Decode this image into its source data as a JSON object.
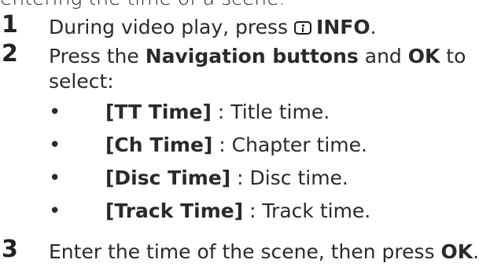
{
  "intro_fragment": "entering the time of a scene.",
  "steps": [
    {
      "number": "1",
      "prefix": "During video play, press ",
      "key_icon": "info-icon",
      "key_label": "INFO",
      "suffix": "."
    },
    {
      "number": "2",
      "prefix": "Press the ",
      "bold1": "Navigation buttons",
      "mid": " and ",
      "bold2": "OK",
      "suffix": " to",
      "line2": "select:"
    },
    {
      "number": "3",
      "prefix": "Enter the time of the scene, then press ",
      "bold": "OK",
      "suffix": "."
    }
  ],
  "options": [
    {
      "bullet": "•",
      "label": "[TT Time]",
      "desc": " : Title time."
    },
    {
      "bullet": "•",
      "label": "[Ch Time]",
      "desc": " : Chapter time."
    },
    {
      "bullet": "•",
      "label": "[Disc Time]",
      "desc": " : Disc time."
    },
    {
      "bullet": "•",
      "label": "[Track Time]",
      "desc": " : Track time."
    }
  ]
}
